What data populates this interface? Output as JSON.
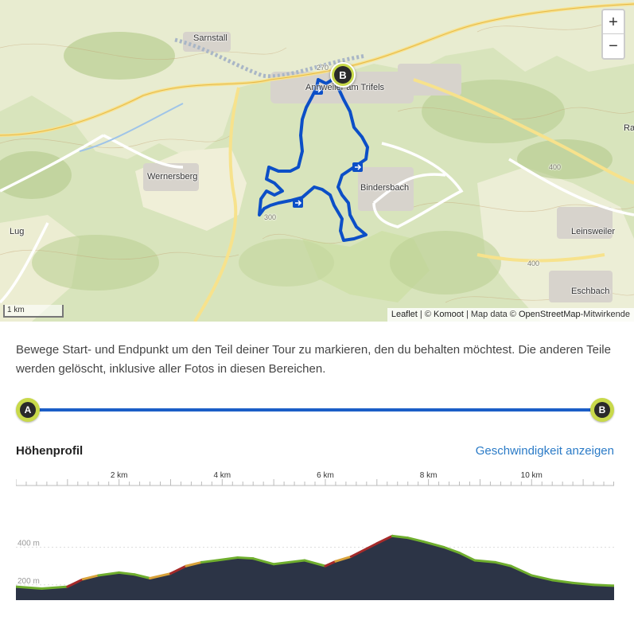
{
  "map": {
    "zoom_in_label": "+",
    "zoom_out_label": "−",
    "scale_label": "1 km",
    "attribution": {
      "leaflet": "Leaflet",
      "sep1": " | © ",
      "komoot": "Komoot",
      "sep2": " | Map data © ",
      "osm": "OpenStreetMap",
      "suffix": "-Mitwirkende"
    },
    "end_marker_label": "B",
    "places": {
      "sarnstall": "Sarnstall",
      "annweiler": "Annweiler am Trifels",
      "wernersberg": "Wernersberg",
      "bindersbach": "Bindersbach",
      "lug": "Lug",
      "leinsweiler": "Leinsweiler",
      "eschbach": "Eschbach",
      "ra": "Ra",
      "contour_400_a": "400",
      "contour_400_b": "400",
      "contour_300": "300",
      "road_270": "270"
    },
    "colors": {
      "route": "#0c4fc7",
      "forest": "#c9dca4",
      "open_land": "#eef0d8",
      "road": "#ffffff",
      "main_road": "#f7e28c"
    }
  },
  "description": "Bewege Start- und Endpunkt um den Teil deiner Tour zu markieren, den du behalten möchtest. Die anderen Teile werden gelöscht, inklusive aller Fotos in diesen Bereichen.",
  "slider": {
    "start_label": "A",
    "end_label": "B",
    "track_color": "#1b5ec7",
    "handle_color": "#c8d94a"
  },
  "profile": {
    "title": "Höhenprofil",
    "speed_link": "Geschwindigkeit anzeigen"
  },
  "chart_data": {
    "type": "area",
    "title": "Höhenprofil",
    "x_unit": "km",
    "x_ticks": [
      2,
      4,
      6,
      8,
      10
    ],
    "x_tick_labels": [
      "2 km",
      "4 km",
      "6 km",
      "8 km",
      "10 km"
    ],
    "xlim": [
      0,
      11.6
    ],
    "y_ticks": [
      200,
      400
    ],
    "y_tick_labels": [
      "200 m",
      "400 m"
    ],
    "ylim": [
      0,
      560
    ],
    "x": [
      0,
      0.5,
      1.0,
      1.3,
      1.6,
      2.0,
      2.3,
      2.6,
      3.0,
      3.3,
      3.6,
      3.9,
      4.3,
      4.6,
      5.0,
      5.3,
      5.6,
      6.0,
      6.2,
      6.5,
      7.0,
      7.3,
      7.6,
      7.9,
      8.3,
      8.6,
      8.9,
      9.3,
      9.6,
      10.0,
      10.4,
      10.8,
      11.2,
      11.6
    ],
    "values": [
      190,
      180,
      190,
      230,
      250,
      265,
      255,
      235,
      260,
      300,
      320,
      330,
      345,
      340,
      310,
      320,
      330,
      300,
      325,
      350,
      420,
      460,
      450,
      430,
      400,
      370,
      330,
      320,
      300,
      250,
      225,
      210,
      200,
      195
    ],
    "fill_color": "#2c3446",
    "line_color": "#6fae2e",
    "steep_colors": [
      "#d8a23a",
      "#a52a2a"
    ]
  }
}
